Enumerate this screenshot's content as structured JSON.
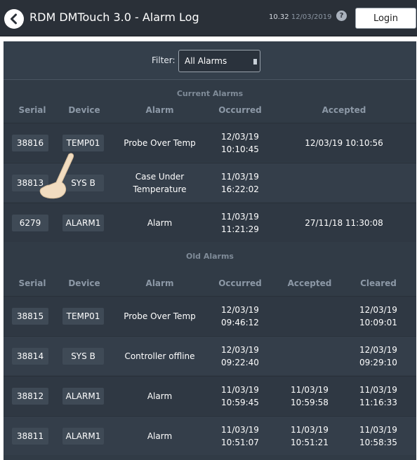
{
  "header": {
    "title": "RDM DMTouch 3.0 - Alarm Log",
    "time": "10.32",
    "date": "12/03/2019",
    "help_label": "?",
    "login_label": "Login",
    "back_icon": "back-arrow-icon"
  },
  "filter": {
    "label": "Filter:",
    "selected": "All Alarms"
  },
  "current": {
    "title": "Current Alarms",
    "headers": [
      "Serial",
      "Device",
      "Alarm",
      "Occurred",
      "Accepted"
    ],
    "rows": [
      {
        "serial": "38816",
        "device": "TEMP01",
        "alarm": [
          "Probe Over Temp"
        ],
        "occurred": [
          "12/03/19",
          "10:10:45"
        ],
        "accepted": "12/03/19 10:10:56"
      },
      {
        "serial": "38813",
        "device": "SYS B",
        "alarm": [
          "Case Under",
          "Temperature"
        ],
        "occurred": [
          "11/03/19",
          "16:22:02"
        ],
        "accepted": ""
      },
      {
        "serial": "6279",
        "device": "ALARM1",
        "alarm": [
          "Alarm"
        ],
        "occurred": [
          "11/03/19",
          "11:21:29"
        ],
        "accepted": "27/11/18 11:30:08"
      }
    ]
  },
  "old": {
    "title": "Old Alarms",
    "headers": [
      "Serial",
      "Device",
      "Alarm",
      "Occurred",
      "Accepted",
      "Cleared"
    ],
    "rows": [
      {
        "serial": "38815",
        "device": "TEMP01",
        "alarm": [
          "Probe Over Temp"
        ],
        "occurred": [
          "12/03/19",
          "09:46:12"
        ],
        "accepted": [
          "",
          ""
        ],
        "cleared": [
          "12/03/19",
          "10:09:01"
        ]
      },
      {
        "serial": "38814",
        "device": "SYS B",
        "alarm": [
          "Controller offline"
        ],
        "occurred": [
          "12/03/19",
          "09:22:40"
        ],
        "accepted": [
          "",
          ""
        ],
        "cleared": [
          "12/03/19",
          "09:29:10"
        ]
      },
      {
        "serial": "38812",
        "device": "ALARM1",
        "alarm": [
          "Alarm"
        ],
        "occurred": [
          "11/03/19",
          "10:59:45"
        ],
        "accepted": [
          "11/03/19",
          "10:59:58"
        ],
        "cleared": [
          "11/03/19",
          "11:16:33"
        ]
      },
      {
        "serial": "38811",
        "device": "ALARM1",
        "alarm": [
          "Alarm"
        ],
        "occurred": [
          "11/03/19",
          "10:51:07"
        ],
        "accepted": [
          "11/03/19",
          "10:51:21"
        ],
        "cleared": [
          "11/03/19",
          "10:58:35"
        ]
      }
    ]
  },
  "colors": {
    "titlebar": "#2a3038",
    "panel": "#313b46",
    "chip": "#3f4a56",
    "header_text": "#8c98a6"
  }
}
